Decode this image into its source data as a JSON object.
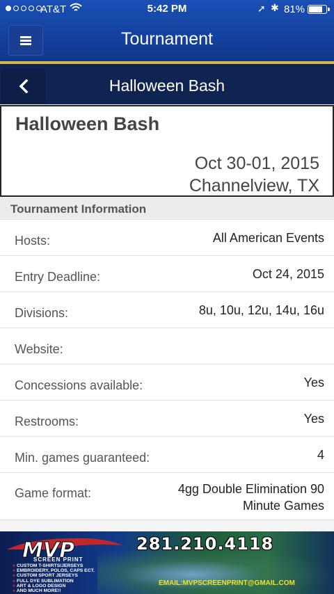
{
  "status_bar": {
    "carrier": "AT&T",
    "time": "5:42 PM",
    "battery": "81%",
    "battery_level": 0.81,
    "icons": [
      "signal-dots",
      "wifi-icon",
      "location-arrow-icon",
      "bluetooth-icon",
      "battery-icon"
    ]
  },
  "app_bar": {
    "title": "Tournament",
    "menu_icon": "hamburger-list-icon"
  },
  "sub_bar": {
    "title": "Halloween Bash",
    "back_icon": "chevron-left-icon"
  },
  "header": {
    "name": "Halloween Bash",
    "date": "Oct 30-01, 2015",
    "location": "Channelview, TX"
  },
  "info": {
    "section_title": "Tournament Information",
    "rows": [
      {
        "label": "Hosts:",
        "value": "All American Events"
      },
      {
        "label": "Entry Deadline:",
        "value": "Oct 24, 2015"
      },
      {
        "label": "Divisions:",
        "value": "8u, 10u, 12u, 14u, 16u"
      },
      {
        "label": "Website:",
        "value": ""
      },
      {
        "label": "Concessions available:",
        "value": "Yes"
      },
      {
        "label": "Restrooms:",
        "value": "Yes"
      },
      {
        "label": "Min. games guaranteed:",
        "value": "4"
      },
      {
        "label": "Game format:",
        "value": "4gg Double Elimination 90 Minute Games"
      }
    ]
  },
  "ad": {
    "logo_text": "MVP",
    "sub_text": "SCREEN PRINT",
    "phone": "281.210.4118",
    "services": [
      "CUSTOM T-SHIRTS/JERSEYS",
      "EMBROIDERY, POLOS, CAPS ECT.",
      "CUSTOM SPORT JERSEYS",
      "FULL DYE SUBLIMATION",
      "ART & LOGO DESIGN",
      "AND MUCH MORE!!"
    ],
    "email": "EMAIL:MVPSCREENPRINT@GMAIL.COM"
  },
  "colors": {
    "app_bar": "#1542a0",
    "sub_bar": "#0f2451",
    "accent_line": "#d9b64a"
  }
}
